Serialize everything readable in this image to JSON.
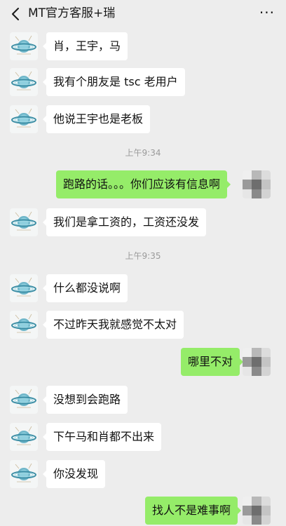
{
  "header": {
    "title": "MT官方客服+瑞",
    "more_label": "···"
  },
  "colors": {
    "background": "#ededed",
    "incoming_bubble": "#ffffff",
    "outgoing_bubble": "#95ec69",
    "timestamp_text": "#9a9a9a"
  },
  "icons": {
    "back": "chevron-left-icon",
    "more": "more-dots-icon",
    "contact_avatar": "planet-logo-avatar",
    "self_avatar": "pixelated-avatar"
  },
  "messages": [
    {
      "type": "in",
      "text": "肖，王宇，马"
    },
    {
      "type": "in",
      "text": "我有个朋友是 tsc 老用户"
    },
    {
      "type": "in",
      "text": "他说王宇也是老板"
    },
    {
      "type": "time",
      "text": "上午9:34"
    },
    {
      "type": "out",
      "text": "跑路的话。。。你们应该有信息啊"
    },
    {
      "type": "in",
      "text": "我们是拿工资的，工资还没发"
    },
    {
      "type": "time",
      "text": "上午9:35"
    },
    {
      "type": "in",
      "text": "什么都没说啊"
    },
    {
      "type": "in",
      "text": "不过昨天我就感觉不太对"
    },
    {
      "type": "out",
      "text": "哪里不对"
    },
    {
      "type": "in",
      "text": "没想到会跑路"
    },
    {
      "type": "in",
      "text": "下午马和肖都不出来"
    },
    {
      "type": "in",
      "text": "你没发现"
    },
    {
      "type": "out",
      "text": "找人不是难事啊"
    }
  ]
}
